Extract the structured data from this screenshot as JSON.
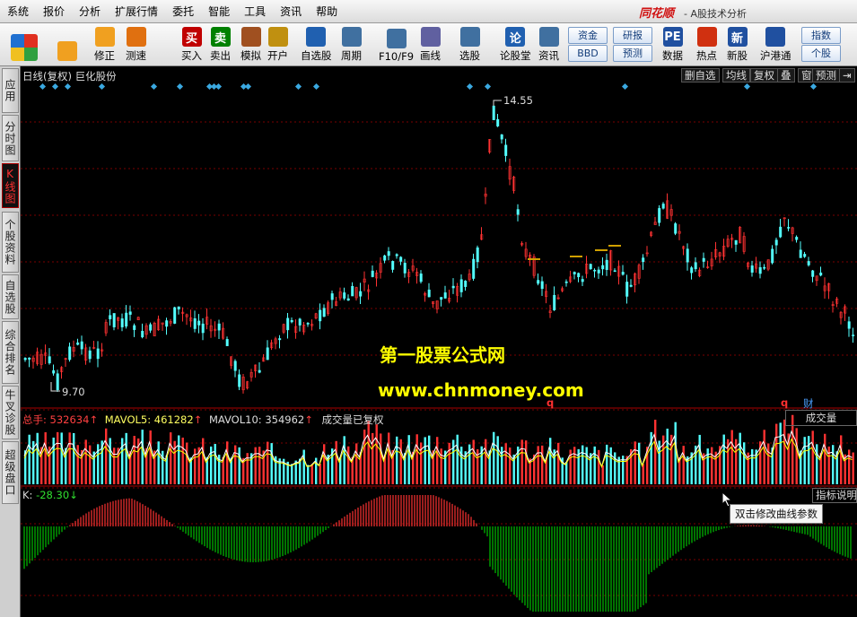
{
  "menu": [
    "系统",
    "报价",
    "分析",
    "扩展行情",
    "委托",
    "智能",
    "工具",
    "资讯",
    "帮助"
  ],
  "app": {
    "logo": "同花顺",
    "title": "- A股技术分析"
  },
  "toolbar": {
    "buttons": [
      {
        "label": "",
        "icon": "windows-icon",
        "color": "#d04020"
      },
      {
        "label": "",
        "icon": "back-arrow-icon",
        "color": "#f0a020"
      },
      {
        "label": "修正",
        "icon": "up-down-arrow-icon",
        "color": "#f0a020"
      },
      {
        "label": "测速",
        "icon": "clock-icon",
        "color": "#e07010"
      },
      {
        "label": "买入",
        "icon": "buy-icon",
        "color": "#c00000"
      },
      {
        "label": "卖出",
        "icon": "sell-icon",
        "color": "#008000"
      },
      {
        "label": "模拟",
        "icon": "hammer-icon",
        "color": "#a05020"
      },
      {
        "label": "开户",
        "icon": "lock-icon",
        "color": "#c09010"
      },
      {
        "label": "自选股",
        "icon": "star-icon",
        "color": "#2060b0"
      },
      {
        "label": "周期",
        "icon": "clock-period-icon",
        "color": "#4070a0"
      },
      {
        "label": "F10/F9",
        "icon": "f10-icon",
        "color": "#4070a0"
      },
      {
        "label": "画线",
        "icon": "pencil-icon",
        "color": "#6060a0"
      },
      {
        "label": "选股",
        "icon": "stock-pick-icon",
        "color": "#4070a0"
      },
      {
        "label": "论股堂",
        "icon": "forum-icon",
        "color": "#2060b0"
      },
      {
        "label": "资讯",
        "icon": "news-icon",
        "color": "#4070a0"
      },
      {
        "label": "数据",
        "icon": "pe-icon",
        "color": "#2050a0"
      },
      {
        "label": "热点",
        "icon": "fire-icon",
        "color": "#d03010"
      },
      {
        "label": "新股",
        "icon": "new-stock-icon",
        "color": "#2050a0"
      },
      {
        "label": "沪港通",
        "icon": "hk-connect-icon",
        "color": "#2050a0"
      }
    ],
    "small_buttons": [
      "资金",
      "BBD",
      "研报",
      "预测",
      "指数",
      "个股"
    ]
  },
  "sidebar": [
    "应用",
    "分时图",
    "K线图",
    "个股资料",
    "自选股",
    "综合排名",
    "牛叉诊股",
    "超级盘口"
  ],
  "chart_header": {
    "title": "日线(复权) 巨化股份",
    "buttons": [
      "删自选",
      "均线",
      "复权",
      "叠",
      "窗",
      "预测"
    ]
  },
  "price": {
    "high_label": "14.55",
    "low_label": "9.70"
  },
  "watermark": {
    "line1": "第一股票公式网",
    "line2": "www.chnmoney.com"
  },
  "markers": {
    "q1": "q",
    "q2": "q",
    "cai": "财"
  },
  "volume": {
    "total_label": "总手:",
    "total": "532634",
    "mavol5_label": "MAVOL5:",
    "mavol5": "461282",
    "mavol10_label": "MAVOL10:",
    "mavol10": "354962",
    "note": "成交量已复权",
    "panel_button": "成交量"
  },
  "indicator": {
    "label": "K:",
    "value": "-28.30",
    "button": "指标说明",
    "tooltip": "双击修改曲线参数"
  },
  "colors": {
    "up": "#ff3232",
    "down": "#54ffff",
    "ma": "#ffffff",
    "ma5": "#ffff00",
    "hist_pos": "#ff3232",
    "hist_neg": "#00c000",
    "grid": "#7a0000"
  }
}
